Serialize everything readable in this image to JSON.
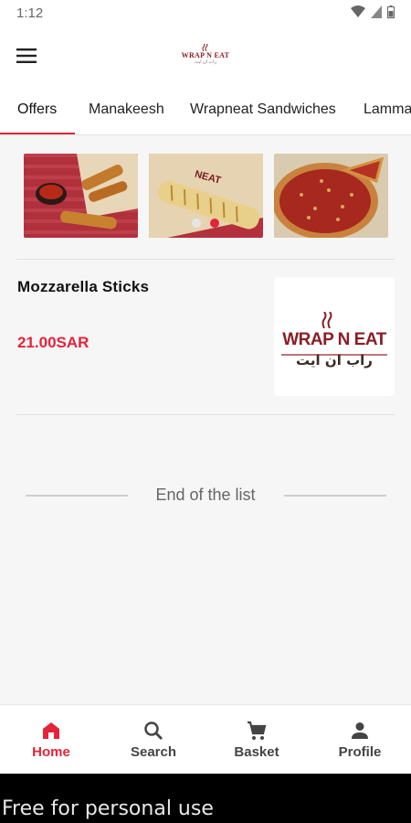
{
  "status_bar": {
    "time": "1:12"
  },
  "app_bar": {
    "menu_icon": "hamburger-menu-icon",
    "logo_text": "WRAP N EAT",
    "logo_sub": "راب ان ايت"
  },
  "tabs": [
    {
      "label": "Offers",
      "active": true
    },
    {
      "label": "Manakeesh"
    },
    {
      "label": "Wrapneat Sandwiches"
    },
    {
      "label": "Lamma"
    }
  ],
  "carousel": {
    "slides": [
      "mozzarella-sticks-photo",
      "wrap-sandwich-photo",
      "pizza-photo"
    ],
    "active_dot": 1
  },
  "product": {
    "name": "Mozzarella Sticks",
    "price": "21.00SAR",
    "image_logo_title": "WRAP N EAT",
    "image_logo_arabic": "راب ان ايت"
  },
  "list_end": {
    "text": "End of the list"
  },
  "bottom_nav": [
    {
      "label": "Home",
      "icon": "home-icon",
      "active": true
    },
    {
      "label": "Search",
      "icon": "search-icon"
    },
    {
      "label": "Basket",
      "icon": "cart-icon"
    },
    {
      "label": "Profile",
      "icon": "person-icon"
    }
  ],
  "footer": {
    "text": "Free for personal use"
  },
  "colors": {
    "accent": "#e5233a",
    "brand": "#8b1d24"
  }
}
